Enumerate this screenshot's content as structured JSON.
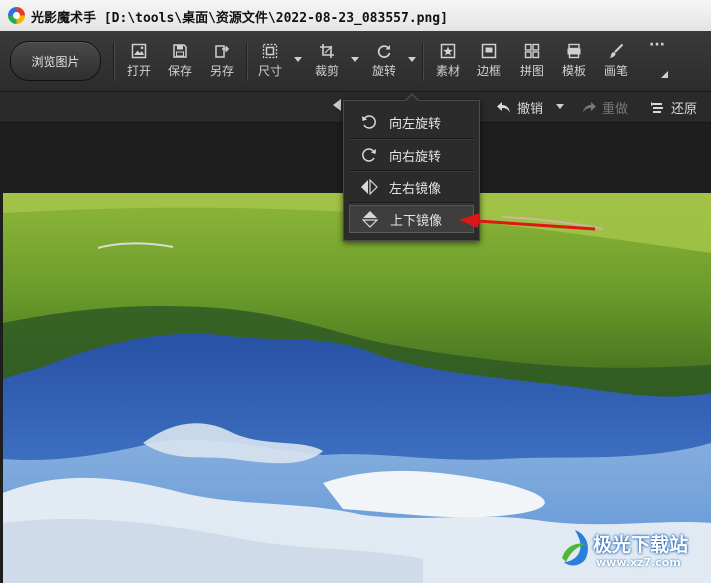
{
  "window": {
    "app_name": "光影魔术手",
    "file_path": "[D:\\tools\\桌面\\资源文件\\2022-08-23_083557.png]"
  },
  "toolbar": {
    "browse_label": "浏览图片",
    "open_label": "打开",
    "save_label": "保存",
    "saveas_label": "另存",
    "size_label": "尺寸",
    "crop_label": "裁剪",
    "rotate_label": "旋转",
    "material_label": "素材",
    "border_label": "边框",
    "collage_label": "拼图",
    "template_label": "模板",
    "brush_label": "画笔",
    "more_label": "···"
  },
  "subbar": {
    "undo_label": "撤销",
    "redo_label": "重做",
    "restore_label": "还原"
  },
  "rotate_menu": {
    "items": [
      {
        "label": "向左旋转",
        "icon": "rotate-left-icon"
      },
      {
        "label": "向右旋转",
        "icon": "rotate-right-icon"
      },
      {
        "label": "左右镜像",
        "icon": "flip-horizontal-icon"
      },
      {
        "label": "上下镜像",
        "icon": "flip-vertical-icon",
        "selected": true
      }
    ]
  },
  "watermark": {
    "main": "极光下载站",
    "url": "www.xz7.com"
  },
  "colors": {
    "toolbar_bg": "#2c2c2c",
    "menu_bg": "#2b2b2b",
    "annotation_arrow": "#e01515"
  }
}
